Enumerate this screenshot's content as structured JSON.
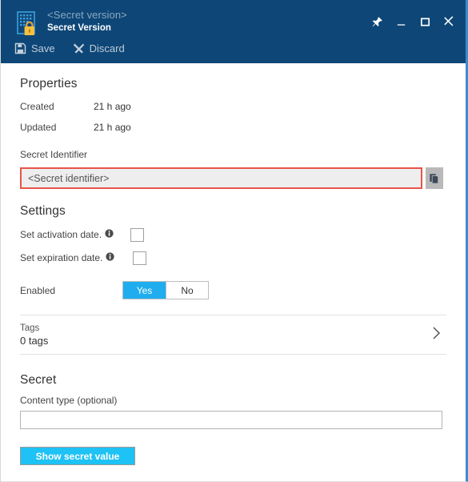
{
  "window": {
    "accent_blue": "#1fadef",
    "header_bg": "#0e4777",
    "highlight_red": "#e8544a",
    "title": "<Secret version>",
    "subtitle": "Secret Version",
    "icon": "key-vault-secret-icon",
    "controls": [
      {
        "name": "pin-icon",
        "label": "Pin"
      },
      {
        "name": "minimize-icon",
        "label": "Minimize"
      },
      {
        "name": "maximize-icon",
        "label": "Maximize"
      },
      {
        "name": "close-icon",
        "label": "Close"
      }
    ]
  },
  "commandbar": {
    "save_label": "Save",
    "save_icon": "save-disk-icon",
    "discard_label": "Discard",
    "discard_icon": "x-icon"
  },
  "properties": {
    "heading": "Properties",
    "rows": [
      {
        "key": "Created",
        "value": "21 h ago"
      },
      {
        "key": "Updated",
        "value": "21 h ago"
      }
    ],
    "secret_identifier_label": "Secret Identifier",
    "secret_identifier_value": "<Secret identifier>",
    "copy_icon": "copy-icon"
  },
  "settings": {
    "heading": "Settings",
    "activation": {
      "label": "Set activation date.",
      "info_icon": "info-icon",
      "checked": false
    },
    "expiration": {
      "label": "Set expiration date.",
      "info_icon": "info-icon",
      "checked": false
    },
    "enabled": {
      "label": "Enabled",
      "yes_label": "Yes",
      "no_label": "No",
      "selected": "Yes"
    }
  },
  "tags": {
    "label": "Tags",
    "value": "0 tags",
    "chevron_icon": "chevron-right-icon"
  },
  "secret": {
    "heading": "Secret",
    "content_type_label": "Content type (optional)",
    "content_type_value": "",
    "content_type_placeholder": "",
    "show_button_label": "Show secret value"
  }
}
